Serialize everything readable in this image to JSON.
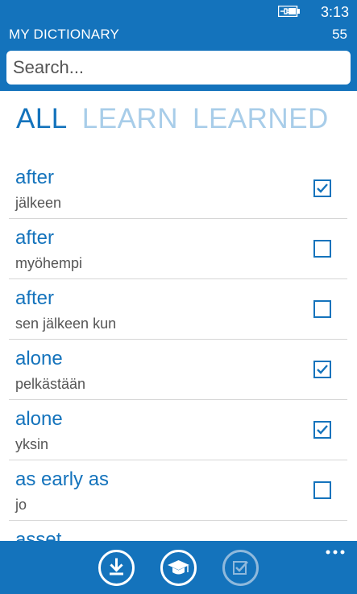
{
  "status": {
    "time": "3:13"
  },
  "header": {
    "title": "MY DICTIONARY",
    "count": "55"
  },
  "search": {
    "placeholder": "Search..."
  },
  "pivot": {
    "tabs": [
      {
        "label": "ALL",
        "active": true
      },
      {
        "label": "LEARN",
        "active": false
      },
      {
        "label": "LEARNED",
        "active": false
      }
    ]
  },
  "words": [
    {
      "word": "after",
      "translation": "jälkeen",
      "learned": true
    },
    {
      "word": "after",
      "translation": "myöhempi",
      "learned": false
    },
    {
      "word": "after",
      "translation": "sen jälkeen kun",
      "learned": false
    },
    {
      "word": "alone",
      "translation": "pelkästään",
      "learned": true
    },
    {
      "word": "alone",
      "translation": "yksin",
      "learned": true
    },
    {
      "word": "as early as",
      "translation": "jo",
      "learned": false
    },
    {
      "word": "asset",
      "translation": "",
      "learned": false
    }
  ],
  "appbar": {
    "buttons": [
      {
        "icon": "download-icon",
        "enabled": true
      },
      {
        "icon": "graduation-cap-icon",
        "enabled": true
      },
      {
        "icon": "checkbox-check-icon",
        "enabled": false
      }
    ],
    "more_icon": "more-dots-icon"
  },
  "colors": {
    "accent": "#1473bc",
    "inactive_tab": "#a8cde9"
  }
}
